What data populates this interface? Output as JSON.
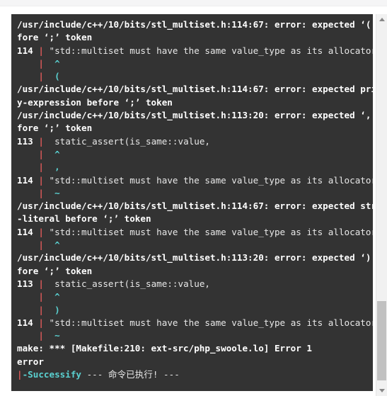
{
  "window": {
    "background_color": "#ffffff",
    "console_background": "#333333"
  },
  "colors": {
    "console_bg": "#333333",
    "text_white": "#e8e8e8",
    "text_bold": "#ffffff",
    "accent_red": "#e05a5a",
    "accent_cyan": "#5ad0d0",
    "scrollbar_track": "#f1f1f1",
    "scrollbar_thumb": "#c1c1c1"
  },
  "console": {
    "lines": [
      {
        "id": "l01",
        "segments": [
          {
            "text": "/usr/include/c++/10/bits/stl_multiset.h:114:67: error: expected ‘(’ be",
            "style": "bold"
          }
        ]
      },
      {
        "id": "l02",
        "segments": [
          {
            "text": "fore ‘;’ token",
            "style": "bold"
          }
        ]
      },
      {
        "id": "l03",
        "segments": [
          {
            "text": "114 ",
            "style": "bold"
          },
          {
            "text": "|",
            "style": "red"
          },
          {
            "text": " \"std::multiset must have the same value_type as its allocator\");",
            "style": "white"
          }
        ]
      },
      {
        "id": "l04",
        "segments": [
          {
            "text": "    ",
            "style": "white"
          },
          {
            "text": "|",
            "style": "red"
          },
          {
            "text": "  ",
            "style": "white"
          },
          {
            "text": "^",
            "style": "cyan"
          }
        ]
      },
      {
        "id": "l05",
        "segments": [
          {
            "text": "    ",
            "style": "white"
          },
          {
            "text": "|",
            "style": "red"
          },
          {
            "text": "  ",
            "style": "white"
          },
          {
            "text": "(",
            "style": "cyan"
          }
        ]
      },
      {
        "id": "l06",
        "segments": [
          {
            "text": "/usr/include/c++/10/bits/stl_multiset.h:114:67: error: expected primar",
            "style": "bold"
          }
        ]
      },
      {
        "id": "l07",
        "segments": [
          {
            "text": "y-expression before ‘;’ token",
            "style": "bold"
          }
        ]
      },
      {
        "id": "l08",
        "segments": [
          {
            "text": "/usr/include/c++/10/bits/stl_multiset.h:113:20: error: expected ‘,’ be",
            "style": "bold"
          }
        ]
      },
      {
        "id": "l09",
        "segments": [
          {
            "text": "fore ‘;’ token",
            "style": "bold"
          }
        ]
      },
      {
        "id": "l10",
        "segments": [
          {
            "text": "113 ",
            "style": "bold"
          },
          {
            "text": "|",
            "style": "red"
          },
          {
            "text": "  static_assert(is_same::value,",
            "style": "white"
          }
        ]
      },
      {
        "id": "l11",
        "segments": [
          {
            "text": "    ",
            "style": "white"
          },
          {
            "text": "|",
            "style": "red"
          },
          {
            "text": "  ",
            "style": "white"
          },
          {
            "text": "^",
            "style": "cyan"
          }
        ]
      },
      {
        "id": "l12",
        "segments": [
          {
            "text": "    ",
            "style": "white"
          },
          {
            "text": "|",
            "style": "red"
          },
          {
            "text": "  ",
            "style": "white"
          },
          {
            "text": ",",
            "style": "cyan"
          }
        ]
      },
      {
        "id": "l13",
        "segments": [
          {
            "text": "114 ",
            "style": "bold"
          },
          {
            "text": "|",
            "style": "red"
          },
          {
            "text": " \"std::multiset must have the same value_type as its allocator\");",
            "style": "white"
          }
        ]
      },
      {
        "id": "l14",
        "segments": [
          {
            "text": "    ",
            "style": "white"
          },
          {
            "text": "|",
            "style": "red"
          },
          {
            "text": "  ",
            "style": "white"
          },
          {
            "text": "~",
            "style": "cyan"
          }
        ]
      },
      {
        "id": "l15",
        "segments": [
          {
            "text": "/usr/include/c++/10/bits/stl_multiset.h:114:67: error: expected string",
            "style": "bold"
          }
        ]
      },
      {
        "id": "l16",
        "segments": [
          {
            "text": "-literal before ‘;’ token",
            "style": "bold"
          }
        ]
      },
      {
        "id": "l17",
        "segments": [
          {
            "text": "114 ",
            "style": "bold"
          },
          {
            "text": "|",
            "style": "red"
          },
          {
            "text": " \"std::multiset must have the same value_type as its allocator\");",
            "style": "white"
          }
        ]
      },
      {
        "id": "l18",
        "segments": [
          {
            "text": "    ",
            "style": "white"
          },
          {
            "text": "|",
            "style": "red"
          },
          {
            "text": "  ",
            "style": "white"
          },
          {
            "text": "^",
            "style": "cyan"
          }
        ]
      },
      {
        "id": "l19",
        "segments": [
          {
            "text": "/usr/include/c++/10/bits/stl_multiset.h:113:20: error: expected ‘)’ be",
            "style": "bold"
          }
        ]
      },
      {
        "id": "l20",
        "segments": [
          {
            "text": "fore ‘;’ token",
            "style": "bold"
          }
        ]
      },
      {
        "id": "l21",
        "segments": [
          {
            "text": "113 ",
            "style": "bold"
          },
          {
            "text": "|",
            "style": "red"
          },
          {
            "text": "  static_assert(is_same::value,",
            "style": "white"
          }
        ]
      },
      {
        "id": "l22",
        "segments": [
          {
            "text": "    ",
            "style": "white"
          },
          {
            "text": "|",
            "style": "red"
          },
          {
            "text": "  ",
            "style": "white"
          },
          {
            "text": "^",
            "style": "cyan"
          }
        ]
      },
      {
        "id": "l23",
        "segments": [
          {
            "text": "    ",
            "style": "white"
          },
          {
            "text": "|",
            "style": "red"
          },
          {
            "text": "  ",
            "style": "white"
          },
          {
            "text": ")",
            "style": "cyan"
          }
        ]
      },
      {
        "id": "l24",
        "segments": [
          {
            "text": "114 ",
            "style": "bold"
          },
          {
            "text": "|",
            "style": "red"
          },
          {
            "text": " \"std::multiset must have the same value_type as its allocator\");",
            "style": "white"
          }
        ]
      },
      {
        "id": "l25",
        "segments": [
          {
            "text": "    ",
            "style": "white"
          },
          {
            "text": "|",
            "style": "red"
          },
          {
            "text": "  ",
            "style": "white"
          },
          {
            "text": "~",
            "style": "cyan"
          }
        ]
      },
      {
        "id": "l26",
        "segments": [
          {
            "text": "make: *** [Makefile:210: ext-src/php_swoole.lo] Error 1",
            "style": "bold"
          }
        ]
      },
      {
        "id": "l27",
        "segments": [
          {
            "text": "error",
            "style": "bold"
          }
        ]
      },
      {
        "id": "l28",
        "segments": [
          {
            "text": "|",
            "style": "red"
          },
          {
            "text": "-Successify",
            "style": "cyan"
          },
          {
            "text": " --- 命令已执行! ---",
            "style": "white"
          }
        ]
      }
    ]
  },
  "scrollbar": {
    "up_arrow": "chevron-up-icon",
    "down_arrow": "chevron-down-icon",
    "thumb_position_percent": 78
  }
}
